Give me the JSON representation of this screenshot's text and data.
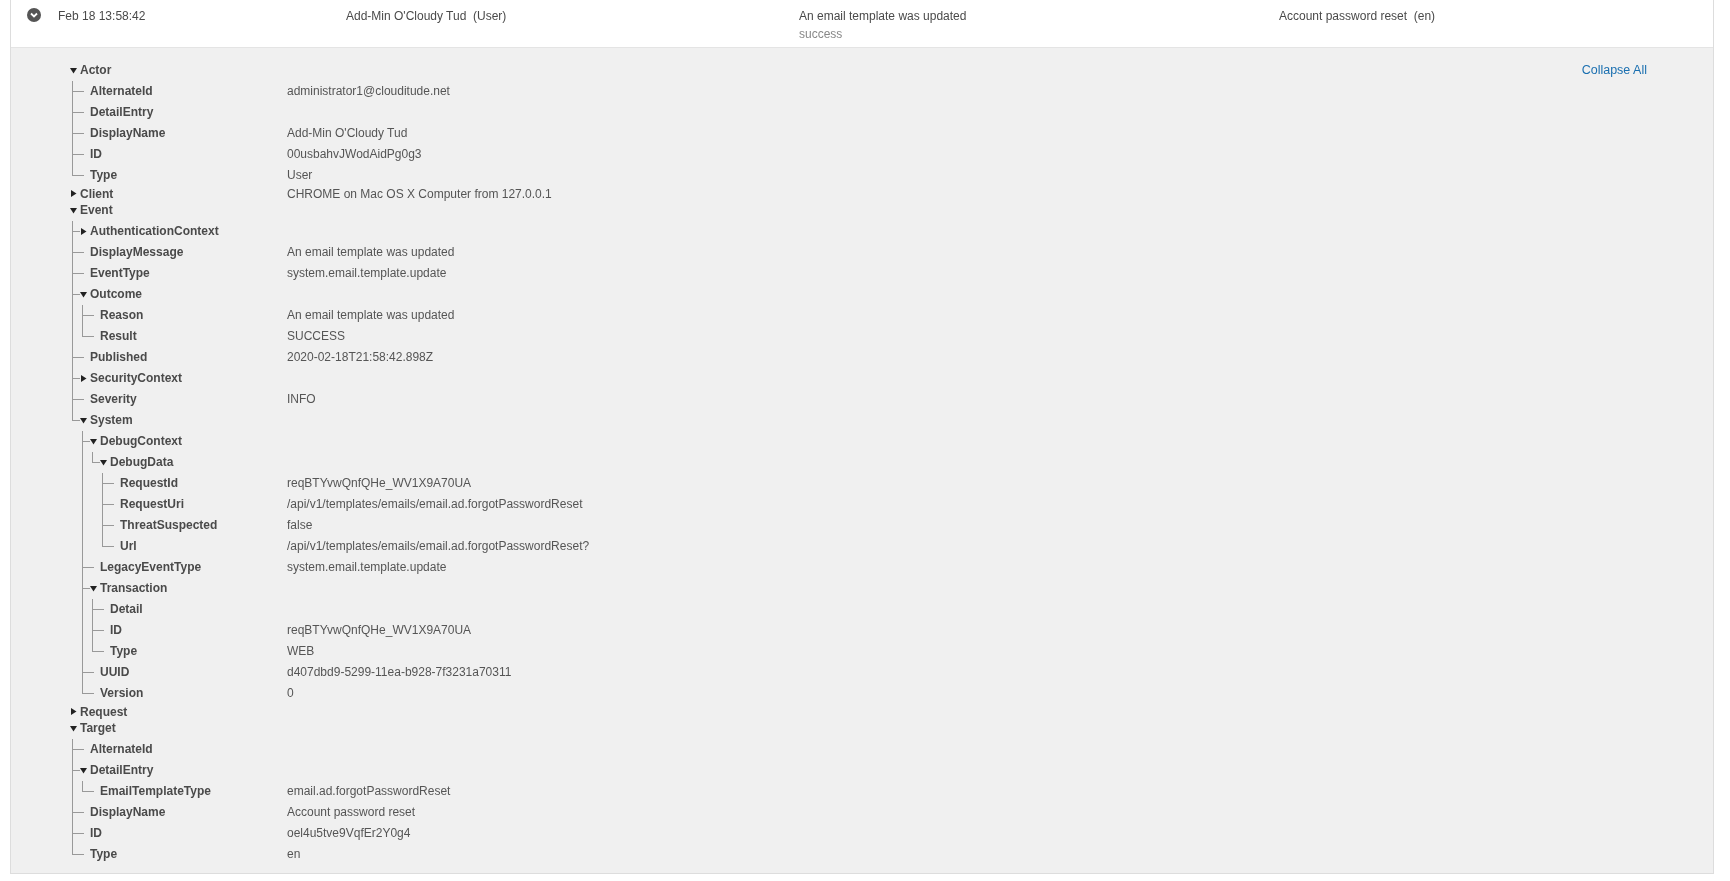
{
  "event_row": {
    "expanded": true,
    "time": "Feb 18 13:58:42",
    "actor": "Add-Min O'Cloudy Tud  (User)",
    "message": "An email template was updated",
    "outcome": "success",
    "target": "Account password reset  (en)"
  },
  "collapse_all": "Collapse All",
  "tree": [
    {
      "label": "Actor",
      "expanded": true,
      "children": [
        {
          "label": "AlternateId",
          "value": "administrator1@clouditude.net"
        },
        {
          "label": "DetailEntry"
        },
        {
          "label": "DisplayName",
          "value": "Add-Min O'Cloudy Tud"
        },
        {
          "label": "ID",
          "value": "00usbahvJWodAidPg0g3"
        },
        {
          "label": "Type",
          "value": "User"
        }
      ]
    },
    {
      "label": "Client",
      "expanded": false,
      "value": "CHROME on Mac OS X Computer from 127.0.0.1"
    },
    {
      "label": "Event",
      "expanded": true,
      "children": [
        {
          "label": "AuthenticationContext",
          "expanded": false
        },
        {
          "label": "DisplayMessage",
          "value": "An email template was updated"
        },
        {
          "label": "EventType",
          "value": "system.email.template.update"
        },
        {
          "label": "Outcome",
          "expanded": true,
          "children": [
            {
              "label": "Reason",
              "value": "An email template was updated"
            },
            {
              "label": "Result",
              "value": "SUCCESS"
            }
          ]
        },
        {
          "label": "Published",
          "value": "2020-02-18T21:58:42.898Z"
        },
        {
          "label": "SecurityContext",
          "expanded": false
        },
        {
          "label": "Severity",
          "value": "INFO"
        },
        {
          "label": "System",
          "expanded": true,
          "children": [
            {
              "label": "DebugContext",
              "expanded": true,
              "children": [
                {
                  "label": "DebugData",
                  "expanded": true,
                  "children": [
                    {
                      "label": "RequestId",
                      "value": "reqBTYvwQnfQHe_WV1X9A70UA"
                    },
                    {
                      "label": "RequestUri",
                      "value": "/api/v1/templates/emails/email.ad.forgotPasswordReset"
                    },
                    {
                      "label": "ThreatSuspected",
                      "value": "false"
                    },
                    {
                      "label": "Url",
                      "value": "/api/v1/templates/emails/email.ad.forgotPasswordReset?"
                    }
                  ]
                }
              ]
            },
            {
              "label": "LegacyEventType",
              "value": "system.email.template.update"
            },
            {
              "label": "Transaction",
              "expanded": true,
              "children": [
                {
                  "label": "Detail"
                },
                {
                  "label": "ID",
                  "value": "reqBTYvwQnfQHe_WV1X9A70UA"
                },
                {
                  "label": "Type",
                  "value": "WEB"
                }
              ]
            },
            {
              "label": "UUID",
              "value": "d407dbd9-5299-11ea-b928-7f3231a70311"
            },
            {
              "label": "Version",
              "value": "0"
            }
          ]
        }
      ]
    },
    {
      "label": "Request",
      "expanded": false
    },
    {
      "label": "Target",
      "expanded": true,
      "children": [
        {
          "label": "AlternateId"
        },
        {
          "label": "DetailEntry",
          "expanded": true,
          "children": [
            {
              "label": "EmailTemplateType",
              "value": "email.ad.forgotPasswordReset"
            }
          ]
        },
        {
          "label": "DisplayName",
          "value": "Account password reset"
        },
        {
          "label": "ID",
          "value": "oel4u5tve9VqfEr2Y0g4"
        },
        {
          "label": "Type",
          "value": "en"
        }
      ]
    }
  ]
}
